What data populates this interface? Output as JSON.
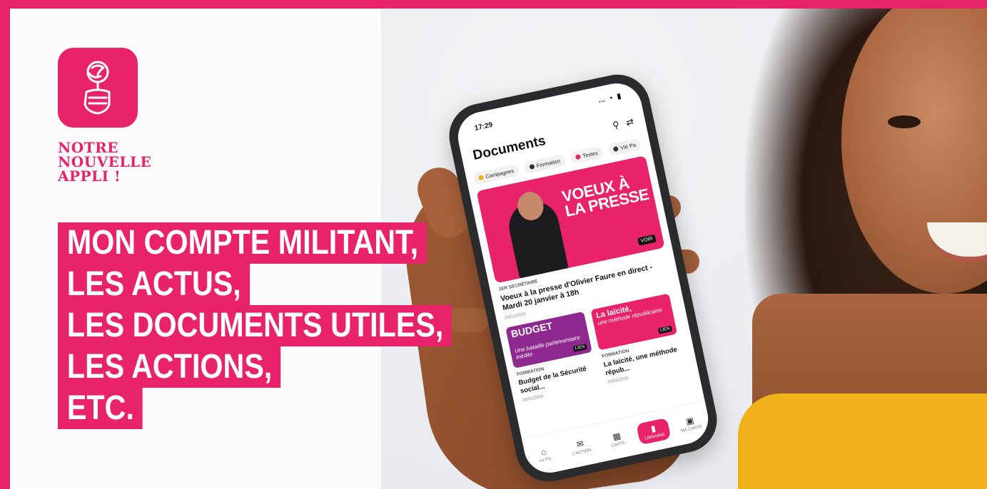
{
  "brand": {
    "color": "#e8236a",
    "logo_icon": "rose-fist-icon"
  },
  "tagline": [
    "NOTRE",
    "NOUVELLE",
    "APPLI !"
  ],
  "headline_lines": [
    "MON COMPTE MILITANT,",
    "LES ACTUS,",
    "LES DOCUMENTS UTILES,",
    "LES ACTIONS,",
    "ETC."
  ],
  "phone": {
    "time": "17:29",
    "status_icons": "… • ▮",
    "screen_title": "Documents",
    "chips": [
      {
        "label": "Formation",
        "color": "#333333"
      },
      {
        "label": "Textes",
        "color": "#e8236a"
      },
      {
        "label": "Vie Pa",
        "color": "#333333"
      },
      {
        "label": "Campagnes",
        "color": "#f1b11a"
      }
    ],
    "hero": {
      "title": "VOEUX À LA PRESSE",
      "badge": "VOIR",
      "category": "1ER SECRÉTAIRE",
      "headline": "Voeux à la presse d'Olivier Faure en direct - Mardi 20 janvier à 18h",
      "date": "20/01/2026"
    },
    "cards": [
      {
        "image_title": "BUDGET",
        "image_sub": "Une bataille parlementaire inédite",
        "badge": "LIEN",
        "category": "FORMATION",
        "headline": "Budget de la Sécurité social...",
        "date": "20/01/2026"
      },
      {
        "image_title": "La laïcité,",
        "image_sub": "une méthode républicaine",
        "badge": "LIEN",
        "category": "FORMATION",
        "headline": "La laïcité, une méthode répub...",
        "date": "20/01/2026"
      }
    ],
    "tabs": [
      {
        "label": "Le PS",
        "icon": "home-icon",
        "active": false
      },
      {
        "label": "L'ACTION",
        "icon": "megaphone-icon",
        "active": false
      },
      {
        "label": "CARTE",
        "icon": "map-icon",
        "active": false
      },
      {
        "label": "LIBRAIRIE",
        "icon": "book-icon",
        "active": true
      },
      {
        "label": "MA CARTE",
        "icon": "card-icon",
        "active": false
      }
    ]
  }
}
